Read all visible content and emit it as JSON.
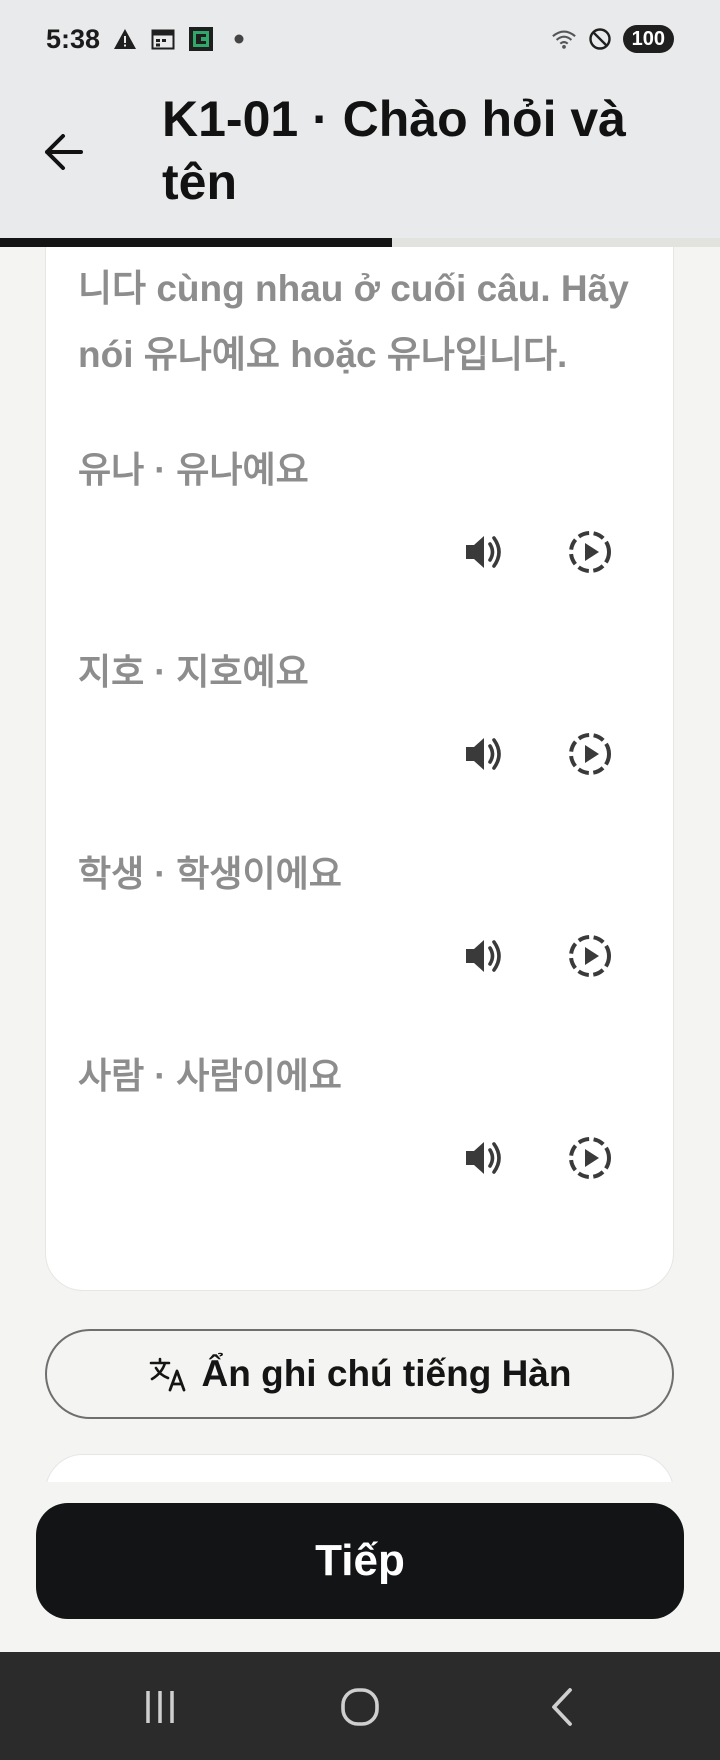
{
  "status_bar": {
    "time": "5:38",
    "battery": "100",
    "left_icons": [
      "warning-icon",
      "calendar-icon",
      "app-icon",
      "dot-icon"
    ],
    "right_icons": [
      "wifi-icon",
      "do-not-disturb-icon"
    ]
  },
  "header": {
    "title": "K1-01 · Chào hỏi và tên",
    "progress": 0.545
  },
  "card": {
    "intro_text": "니다 cùng nhau ở cuối câu. Hãy nói 유나예요 hoặc 유나입니다.",
    "items": [
      {
        "text": "유나 · 유나예요"
      },
      {
        "text": "지호 · 지호예요"
      },
      {
        "text": "학생 · 학생이에요"
      },
      {
        "text": "사람 · 사람이에요"
      }
    ]
  },
  "toggle_button": {
    "label": "Ẩn ghi chú tiếng Hàn",
    "icon": "translate-icon"
  },
  "footer": {
    "next_label": "Tiếp"
  },
  "colors": {
    "header_bg": "#e9eaeb",
    "page_bg": "#f4f4f2",
    "muted_text": "#8d8d8d",
    "primary_button": "#131416"
  }
}
